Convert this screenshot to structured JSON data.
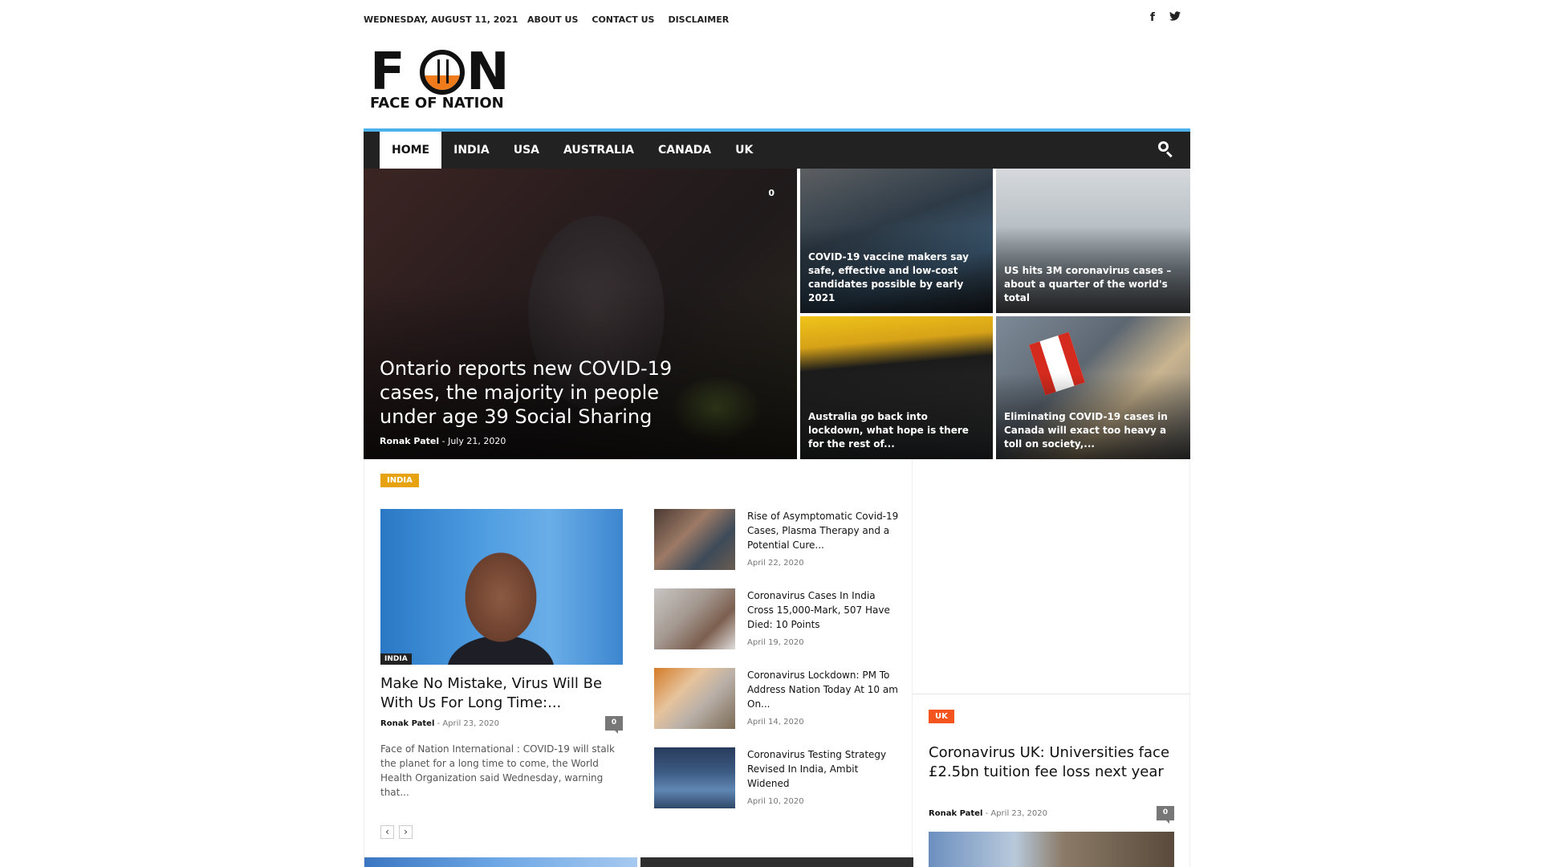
{
  "topbar": {
    "date": "WEDNESDAY, AUGUST 11, 2021",
    "menu": [
      "ABOUT US",
      "CONTACT US",
      "DISCLAIMER"
    ],
    "social": [
      {
        "icon": "facebook-icon",
        "glyph": "f"
      },
      {
        "icon": "twitter-icon",
        "glyph": "🐦"
      }
    ]
  },
  "logo": {
    "big_f": "F",
    "big_n": "N",
    "tagline": "FACE OF NATION"
  },
  "nav": {
    "items": [
      "HOME",
      "INDIA",
      "USA",
      "AUSTRALIA",
      "CANADA",
      "UK"
    ],
    "active": "HOME",
    "accent": "#4db2ec"
  },
  "hero": {
    "main": {
      "title": "Ontario reports new COVID-19 cases, the majority in people under age 39 Social Sharing",
      "author": "Ronak Patel",
      "date": "July 21, 2020",
      "comments": "0"
    },
    "tiles": [
      {
        "title": "COVID-19 vaccine makers say safe, effective and low-cost candidates possible by early 2021"
      },
      {
        "title": "US hits 3M coronavirus cases – about a quarter of the world's total"
      },
      {
        "title": "Australia go back into lockdown, what hope is there for the rest of..."
      },
      {
        "title": "Eliminating COVID-19 cases in Canada will exact too heavy a toll on society,..."
      }
    ]
  },
  "india_block": {
    "badge": "INDIA",
    "badge_color": "#e7a30e",
    "featured": {
      "category": "INDIA",
      "title": "Make No Mistake, Virus Will Be With Us For Long Time:...",
      "author": "Ronak Patel",
      "date": "April 23, 2020",
      "comments": "0",
      "excerpt": "Face of Nation International : COVID-19 will stalk the planet for a long time to come, the World Health Organization said Wednesday, warning that..."
    },
    "list": [
      {
        "title": "Rise of Asymptomatic Covid-19 Cases, Plasma Therapy and a Potential Cure...",
        "date": "April 22, 2020"
      },
      {
        "title": "Coronavirus Cases In India Cross 15,000-Mark, 507 Have Died: 10 Points",
        "date": "April 19, 2020"
      },
      {
        "title": "Coronavirus Lockdown: PM To Address Nation Today At 10 am On...",
        "date": "April 14, 2020"
      },
      {
        "title": "Coronavirus Testing Strategy Revised In India, Ambit Widened",
        "date": "April 10, 2020"
      }
    ],
    "pager": {
      "prev": "‹",
      "next": "›"
    }
  },
  "uk_block": {
    "badge": "UK",
    "badge_color": "#f4551f",
    "title": "Coronavirus UK: Universities face £2.5bn tuition fee loss next year",
    "author": "Ronak Patel",
    "date": "April 23, 2020",
    "comments": "0"
  }
}
